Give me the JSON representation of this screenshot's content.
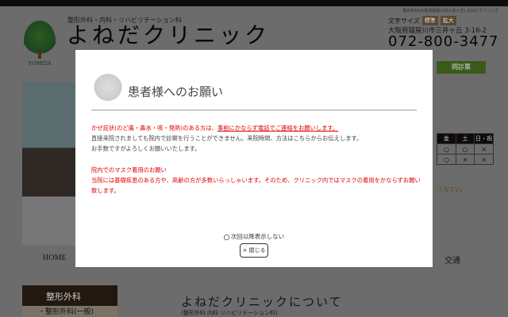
{
  "header": {
    "tagline": "整形外科(大阪府寝屋川市三井ヶ丘) よねだクリニック",
    "logo_text": "YONEDA",
    "subtitle": "整形外科・内科・リハビリテーション科",
    "title": "よねだクリニック",
    "font_size_label": "文字サイズ",
    "font_size_standard": "標準",
    "font_size_large": "拡大",
    "address": "大阪府寝屋川市三井ヶ丘 3-16-2",
    "phone": "072-800-3477",
    "green_button": "問診票"
  },
  "schedule": {
    "headers": [
      "金",
      "土",
      "日・祝"
    ],
    "rows": [
      [
        "○",
        "○",
        "×"
      ],
      [
        "○",
        "×",
        "×"
      ]
    ],
    "note": "ください。"
  },
  "nav": {
    "items": [
      "HOME",
      "",
      "",
      "",
      "交通"
    ]
  },
  "sidebar": {
    "heading": "整形外科",
    "item": "・整形外科(一般)"
  },
  "about": {
    "title": "よねだクリニックについて",
    "subtitle": "(整形外科 内科 リハビリテーション科)"
  },
  "modal": {
    "title": "患者様へのお願い",
    "p1_red": "かぜ症状(のど痛・鼻水・咳・発熱)のある方は、",
    "p1_red_underline": "事前にかならず電話でご連絡をお願いします。",
    "p1_line2": "直接来院されましても院内で診察を行うことができません。来院時間、方法はこちらからお伝えします。",
    "p1_line3": "お手数ですがよろしくお願いいたします。",
    "p2_heading": "院内でのマスク着用のお願い",
    "p2_body": "当院には基礎疾患のある方や、高齢の方が多数いらっしゃいます。そのため、クリニック内ではマスクの着用をかならずお願い致します。",
    "dont_show_again": "次回以降表示しない",
    "dont_show_checked": false,
    "close_button": "× 閉じる"
  }
}
